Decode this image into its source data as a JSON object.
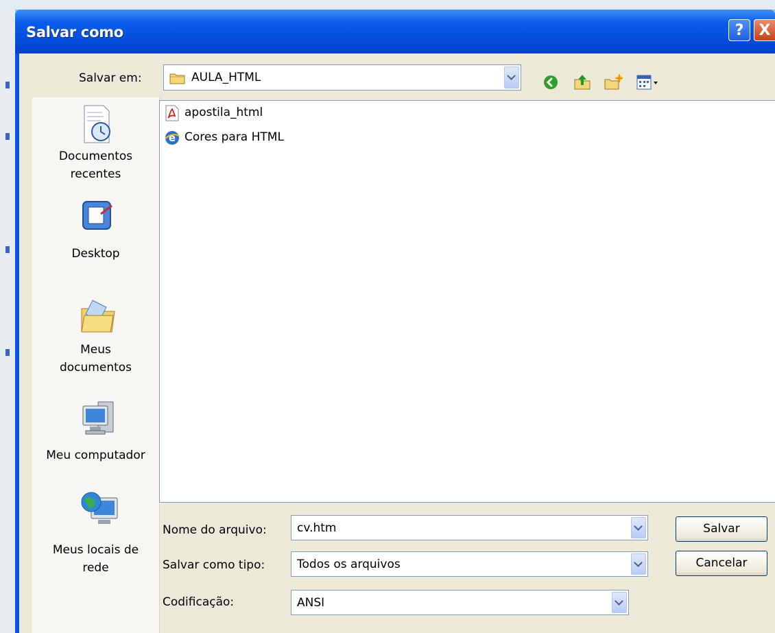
{
  "dialog": {
    "title": "Salvar como",
    "help_button": "?",
    "close_button": "X"
  },
  "save_in": {
    "label": "Salvar em:",
    "value": "AULA_HTML"
  },
  "toolbar": {
    "icons": [
      "back-icon",
      "up-folder-icon",
      "new-folder-icon",
      "view-menu-icon"
    ]
  },
  "places": [
    {
      "label_line1": "Documentos",
      "label_line2": "recentes",
      "icon": "recent-documents-icon"
    },
    {
      "label_line1": "Desktop",
      "label_line2": "",
      "icon": "desktop-icon"
    },
    {
      "label_line1": "Meus",
      "label_line2": "documentos",
      "icon": "my-documents-icon"
    },
    {
      "label_line1": "Meu computador",
      "label_line2": "",
      "icon": "my-computer-icon"
    },
    {
      "label_line1": "Meus locais de",
      "label_line2": "rede",
      "icon": "network-places-icon"
    }
  ],
  "files": [
    {
      "name": "apostila_html",
      "icon": "pdf-file-icon"
    },
    {
      "name": "Cores para HTML",
      "icon": "ie-html-file-icon"
    }
  ],
  "form": {
    "filename_label": "Nome do arquivo:",
    "filename_value": "cv.htm",
    "type_label": "Salvar como tipo:",
    "type_value": "Todos os arquivos",
    "encoding_label": "Codificação:",
    "encoding_value": "ANSI"
  },
  "buttons": {
    "save": "Salvar",
    "cancel": "Cancelar"
  },
  "colors": {
    "titlebar": "#0a55e0",
    "dialog_bg": "#ece9d8",
    "desktop_bg": "#aec5cf"
  }
}
